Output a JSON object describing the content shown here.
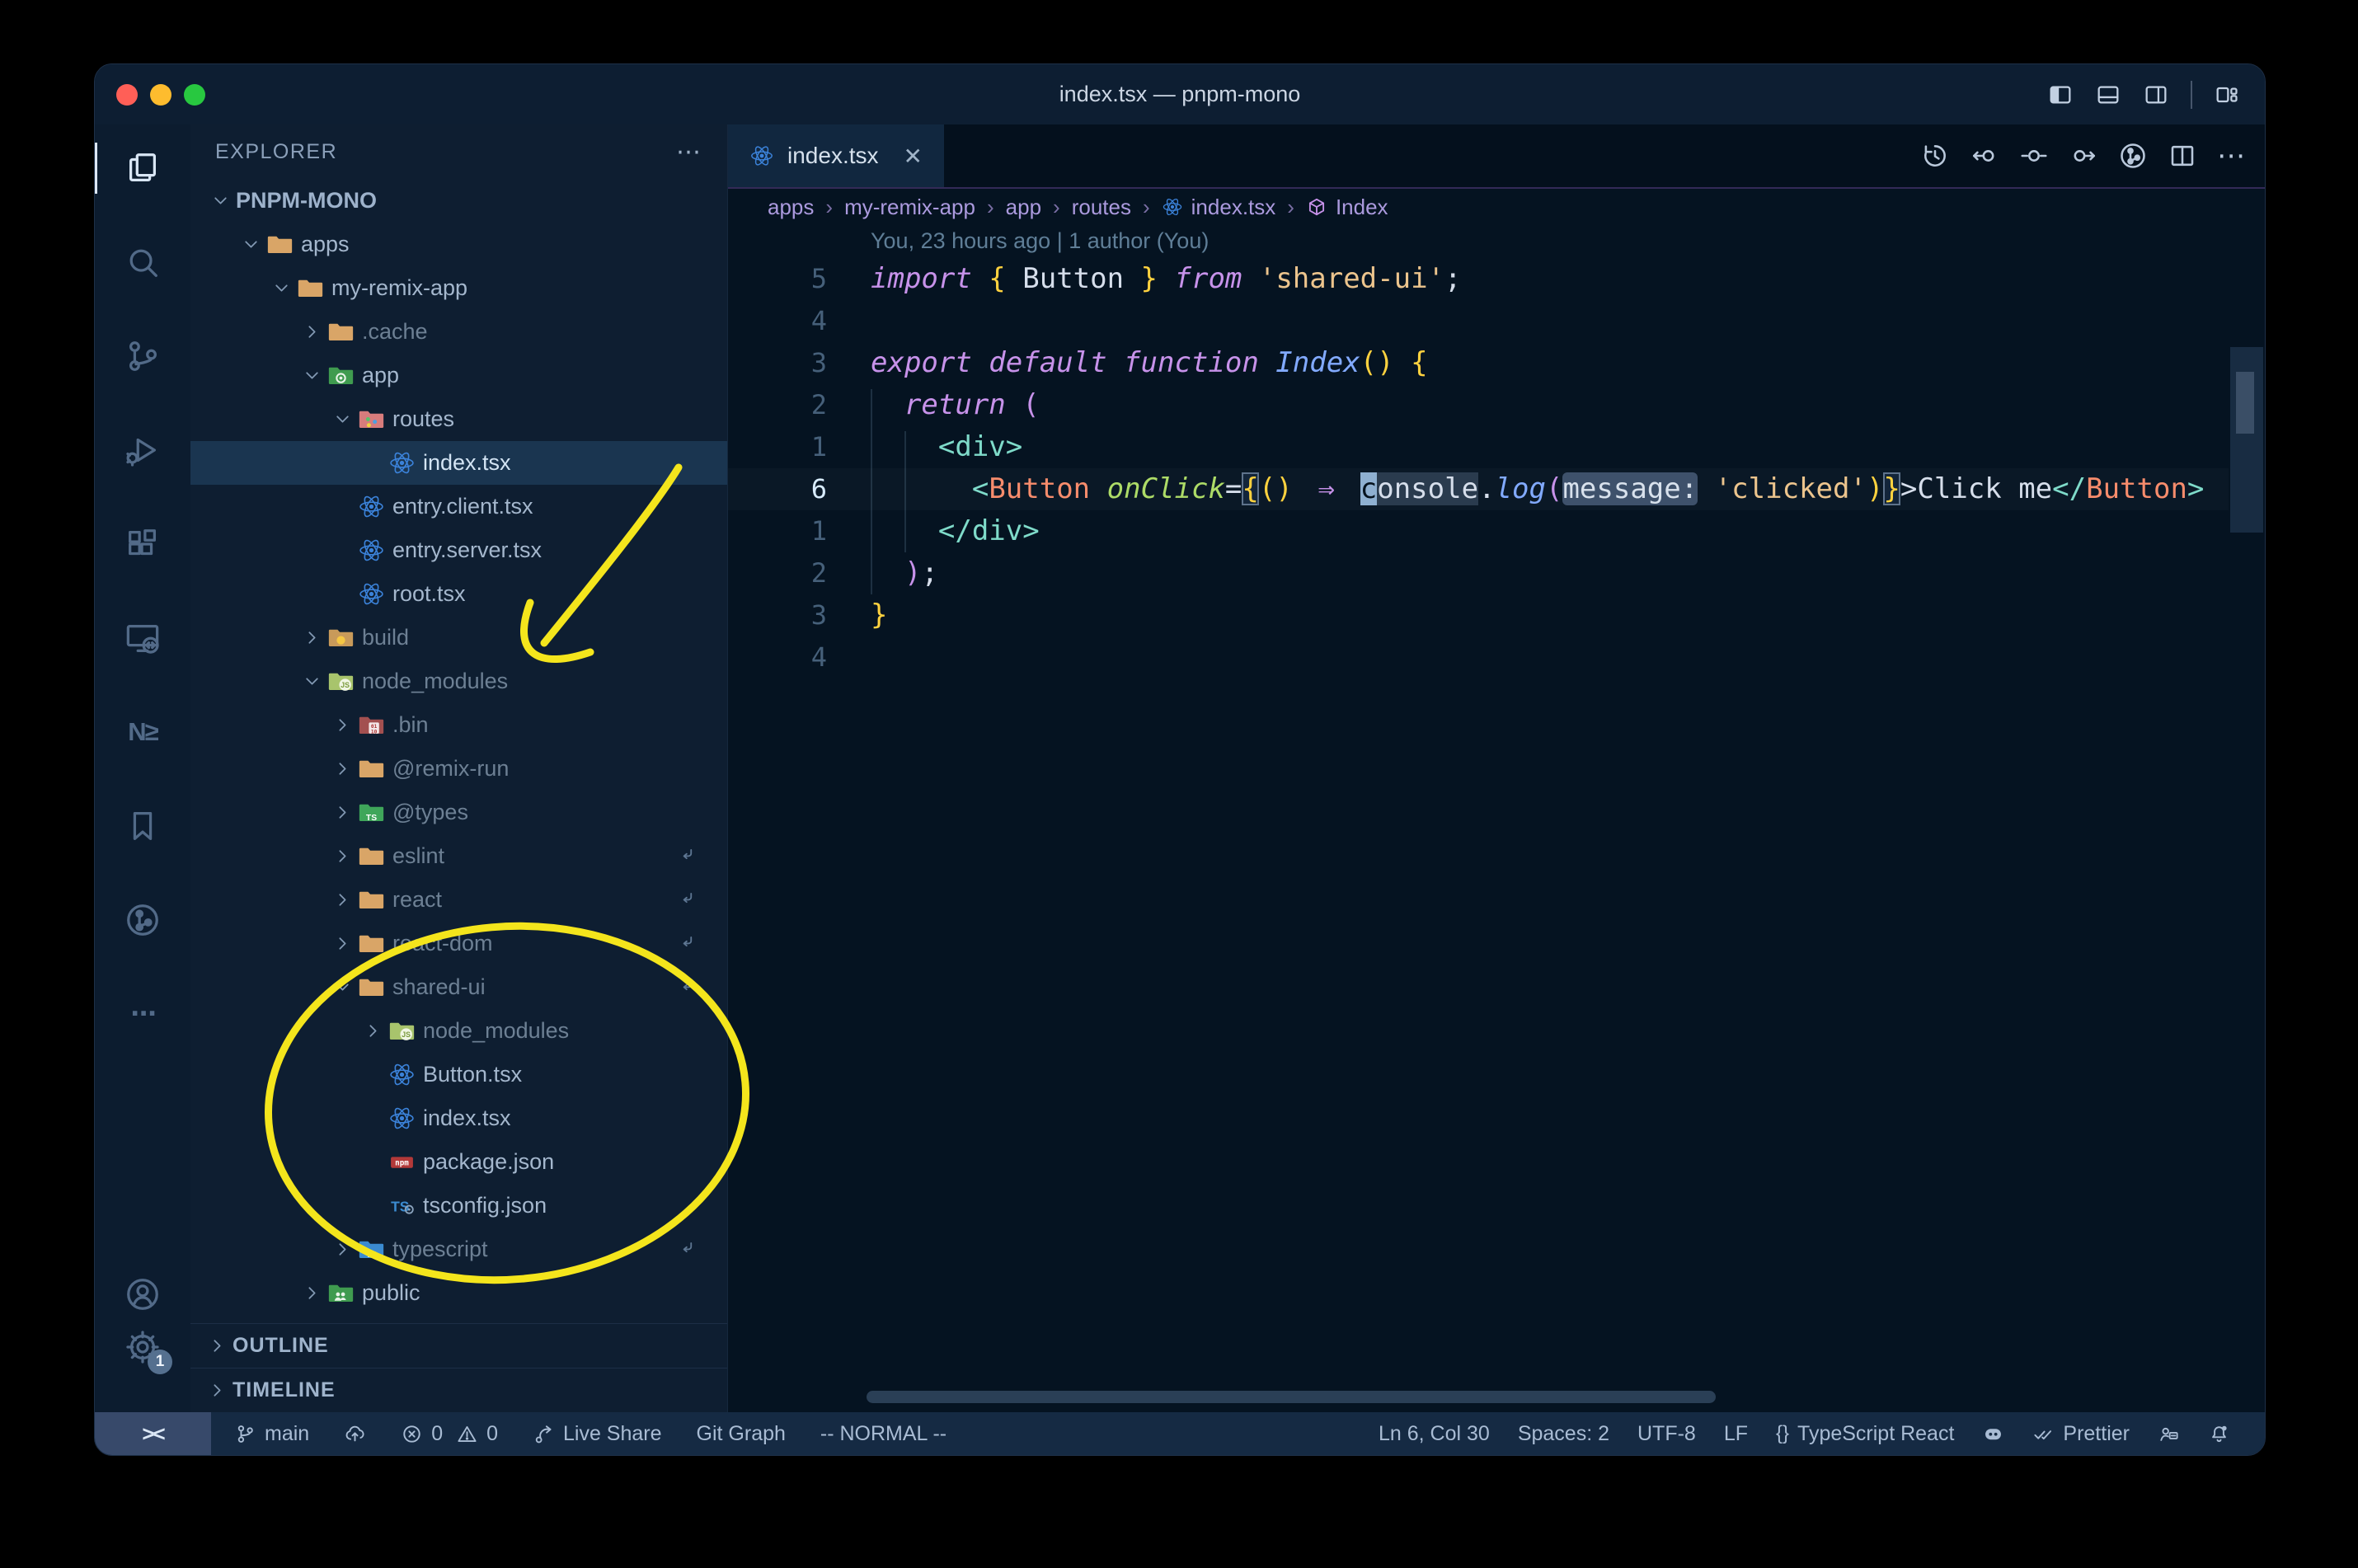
{
  "theme": {
    "editor_bg": "#051321",
    "sidebar_bg": "#0e1e31",
    "titlebar_bg": "#0d1e32",
    "statusbar_bg": "#152a43",
    "tab_active_bg": "#11273f",
    "selection_row": "#1a3550",
    "annotation_yellow": "#f4e51c",
    "react_blue": "#3b82d9",
    "folder_tan": "#d9a567",
    "keyword_pink": "#c792ea",
    "string_orange": "#ecc48d",
    "brace_yellow": "#ffd23f",
    "tag_teal": "#7fdbca",
    "component_salmon": "#f78c6c",
    "attr_green": "#addb67",
    "function_blue": "#82aaff"
  },
  "window": {
    "title": "index.tsx — pnpm-mono",
    "traffic_lights": [
      "#ff5f57",
      "#febc2e",
      "#28c840"
    ]
  },
  "titlebar_actions": [
    {
      "name": "toggle-primary-sidebar",
      "icon": "panel-left"
    },
    {
      "name": "toggle-panel",
      "icon": "panel-bottom"
    },
    {
      "name": "toggle-secondary-sidebar",
      "icon": "panel-right"
    },
    {
      "name": "divider",
      "icon": "divider"
    },
    {
      "name": "customize-layout",
      "icon": "layout"
    }
  ],
  "activity_bar": {
    "top": [
      {
        "name": "explorer",
        "icon": "files",
        "active": true
      },
      {
        "name": "search",
        "icon": "search"
      },
      {
        "name": "source-control",
        "icon": "scm"
      },
      {
        "name": "run-debug",
        "icon": "debug"
      },
      {
        "name": "extensions",
        "icon": "extensions"
      },
      {
        "name": "remote-explorer",
        "icon": "remote"
      },
      {
        "name": "nx-console",
        "icon": "nx",
        "glyph": "N≥"
      },
      {
        "name": "bookmarks",
        "icon": "bookmark"
      },
      {
        "name": "git-graph",
        "icon": "gitgraph"
      },
      {
        "name": "more",
        "icon": "more",
        "glyph": "⋯"
      }
    ],
    "bottom": [
      {
        "name": "accounts",
        "icon": "account"
      },
      {
        "name": "settings",
        "icon": "gear",
        "badge": "1"
      }
    ]
  },
  "sidebar": {
    "header": "EXPLORER",
    "header_more": "⋯",
    "tree": [
      {
        "label": "PNPM-MONO",
        "depth": 0,
        "chevron": "down",
        "icon": "",
        "root": true
      },
      {
        "label": "apps",
        "depth": 1,
        "chevron": "down",
        "icon": "folder"
      },
      {
        "label": "my-remix-app",
        "depth": 2,
        "chevron": "down",
        "icon": "folder"
      },
      {
        "label": ".cache",
        "depth": 3,
        "chevron": "right",
        "icon": "folder",
        "dim": true
      },
      {
        "label": "app",
        "depth": 3,
        "chevron": "down",
        "icon": "folder-app"
      },
      {
        "label": "routes",
        "depth": 4,
        "chevron": "down",
        "icon": "folder-routes"
      },
      {
        "label": "index.tsx",
        "depth": 5,
        "chevron": "none",
        "icon": "react",
        "selected": true
      },
      {
        "label": "entry.client.tsx",
        "depth": 4,
        "chevron": "none",
        "icon": "react"
      },
      {
        "label": "entry.server.tsx",
        "depth": 4,
        "chevron": "none",
        "icon": "react"
      },
      {
        "label": "root.tsx",
        "depth": 4,
        "chevron": "none",
        "icon": "react"
      },
      {
        "label": "build",
        "depth": 3,
        "chevron": "right",
        "icon": "folder-build",
        "dim": true
      },
      {
        "label": "node_modules",
        "depth": 3,
        "chevron": "down",
        "icon": "folder-js",
        "dim": true
      },
      {
        "label": ".bin",
        "depth": 4,
        "chevron": "right",
        "icon": "folder-bin",
        "dim": true
      },
      {
        "label": "@remix-run",
        "depth": 4,
        "chevron": "right",
        "icon": "folder",
        "dim": true
      },
      {
        "label": "@types",
        "depth": 4,
        "chevron": "right",
        "icon": "folder-ts",
        "dim": true
      },
      {
        "label": "eslint",
        "depth": 4,
        "chevron": "right",
        "icon": "folder",
        "dim": true,
        "symlink": true
      },
      {
        "label": "react",
        "depth": 4,
        "chevron": "right",
        "icon": "folder",
        "dim": true,
        "symlink": true
      },
      {
        "label": "react-dom",
        "depth": 4,
        "chevron": "right",
        "icon": "folder",
        "dim": true,
        "symlink": true
      },
      {
        "label": "shared-ui",
        "depth": 4,
        "chevron": "down",
        "icon": "folder",
        "dim": true,
        "symlink": true
      },
      {
        "label": "node_modules",
        "depth": 5,
        "chevron": "right",
        "icon": "folder-js",
        "dim": true
      },
      {
        "label": "Button.tsx",
        "depth": 5,
        "chevron": "none",
        "icon": "react"
      },
      {
        "label": "index.tsx",
        "depth": 5,
        "chevron": "none",
        "icon": "react"
      },
      {
        "label": "package.json",
        "depth": 5,
        "chevron": "none",
        "icon": "npm"
      },
      {
        "label": "tsconfig.json",
        "depth": 5,
        "chevron": "none",
        "icon": "tsconfig"
      },
      {
        "label": "typescript",
        "depth": 4,
        "chevron": "right",
        "icon": "folder-tsblue",
        "dim": true,
        "symlink": true
      },
      {
        "label": "public",
        "depth": 3,
        "chevron": "right",
        "icon": "folder-public"
      }
    ],
    "sections": [
      {
        "label": "OUTLINE"
      },
      {
        "label": "TIMELINE"
      }
    ]
  },
  "editor": {
    "tabs": [
      {
        "label": "index.tsx",
        "icon": "react",
        "active": true,
        "close": "✕"
      }
    ],
    "actions": [
      {
        "name": "timeline-history",
        "icon": "history"
      },
      {
        "name": "previous-change",
        "icon": "scm-prev"
      },
      {
        "name": "current-change",
        "icon": "scm-dot"
      },
      {
        "name": "next-change",
        "icon": "scm-next"
      },
      {
        "name": "git-graph-view",
        "icon": "gitgraph"
      },
      {
        "name": "split-editor",
        "icon": "split"
      },
      {
        "name": "more-actions",
        "icon": "more",
        "glyph": "⋯"
      }
    ],
    "breadcrumbs": [
      {
        "label": "apps"
      },
      {
        "label": "my-remix-app"
      },
      {
        "label": "app"
      },
      {
        "label": "routes"
      },
      {
        "label": "index.tsx",
        "icon": "react"
      },
      {
        "label": "Index",
        "icon": "cube"
      }
    ],
    "blame": "You, 23 hours ago | 1 author (You)",
    "lines": [
      {
        "num": "5",
        "tokens": [
          [
            "kw",
            "import "
          ],
          [
            "yel",
            "{"
          ],
          [
            "def",
            " Button "
          ],
          [
            "yel",
            "}"
          ],
          [
            "kw",
            " from "
          ],
          [
            "str",
            "'shared-ui'"
          ],
          [
            "def",
            ";"
          ]
        ]
      },
      {
        "num": "4",
        "tokens": []
      },
      {
        "num": "3",
        "tokens": [
          [
            "kw",
            "export default function "
          ],
          [
            "fn",
            "Index"
          ],
          [
            "yel",
            "()"
          ],
          [
            "def",
            " "
          ],
          [
            "yel",
            "{"
          ]
        ]
      },
      {
        "num": "2",
        "tokens": [
          [
            "def",
            "  "
          ],
          [
            "kw",
            "return "
          ],
          [
            "mag",
            "("
          ]
        ]
      },
      {
        "num": "1",
        "tokens": [
          [
            "def",
            "    "
          ],
          [
            "tag",
            "<div>"
          ]
        ]
      },
      {
        "num": "6",
        "active": true,
        "tokens": [
          [
            "def",
            "      "
          ],
          [
            "tag",
            "<"
          ],
          [
            "cmp",
            "Button"
          ],
          [
            "def",
            " "
          ],
          [
            "attr",
            "onClick"
          ],
          [
            "def",
            "="
          ],
          [
            "brk",
            "{"
          ],
          [
            "yel",
            "()"
          ],
          [
            "def",
            " "
          ],
          [
            "arrow",
            "⇒"
          ],
          [
            "def",
            " "
          ],
          [
            "cursor",
            "c"
          ],
          [
            "hl",
            "onsole"
          ],
          [
            "def",
            "."
          ],
          [
            "fn",
            "log"
          ],
          [
            "mag",
            "("
          ],
          [
            "inlay",
            "message:"
          ],
          [
            "def",
            " "
          ],
          [
            "str",
            "'clicked'"
          ],
          [
            "yel",
            ")"
          ],
          [
            "brk",
            "}"
          ],
          [
            "def",
            ">Click me"
          ],
          [
            "tag",
            "</"
          ],
          [
            "cmp",
            "Button"
          ],
          [
            "tag",
            ">"
          ]
        ]
      },
      {
        "num": "1",
        "tokens": [
          [
            "def",
            "    "
          ],
          [
            "tag",
            "</div>"
          ]
        ]
      },
      {
        "num": "2",
        "tokens": [
          [
            "def",
            "  "
          ],
          [
            "mag",
            ")"
          ],
          [
            "def",
            ";"
          ]
        ]
      },
      {
        "num": "3",
        "tokens": [
          [
            "yel",
            "}"
          ]
        ]
      },
      {
        "num": "4",
        "tokens": []
      }
    ]
  },
  "status_bar": {
    "left": [
      {
        "name": "remote-indicator",
        "label": "><",
        "box": true
      },
      {
        "name": "git-branch",
        "icon": "branch",
        "label": "main"
      },
      {
        "name": "publish-changes",
        "icon": "cloud-up",
        "label": ""
      },
      {
        "name": "errors",
        "icon": "error",
        "label": "0",
        "tight": true
      },
      {
        "name": "warnings",
        "icon": "warning",
        "label": "0"
      },
      {
        "name": "live-share",
        "icon": "liveshare",
        "label": "Live Share"
      },
      {
        "name": "git-graph",
        "label": "Git Graph"
      },
      {
        "name": "vim-mode",
        "label": "-- NORMAL --"
      }
    ],
    "right": [
      {
        "name": "cursor-position",
        "label": "Ln 6, Col 30"
      },
      {
        "name": "indentation",
        "label": "Spaces: 2"
      },
      {
        "name": "encoding",
        "label": "UTF-8"
      },
      {
        "name": "eol",
        "label": "LF"
      },
      {
        "name": "language-mode",
        "glyph": "{}",
        "label": "TypeScript React"
      },
      {
        "name": "copilot",
        "icon": "copilot",
        "label": ""
      },
      {
        "name": "formatter-prettier",
        "icon": "check-double",
        "label": "Prettier"
      },
      {
        "name": "feedback",
        "icon": "feedback",
        "label": ""
      },
      {
        "name": "notifications",
        "icon": "bell",
        "label": ""
      }
    ]
  },
  "annotations": {
    "color": "#f4e51c"
  }
}
